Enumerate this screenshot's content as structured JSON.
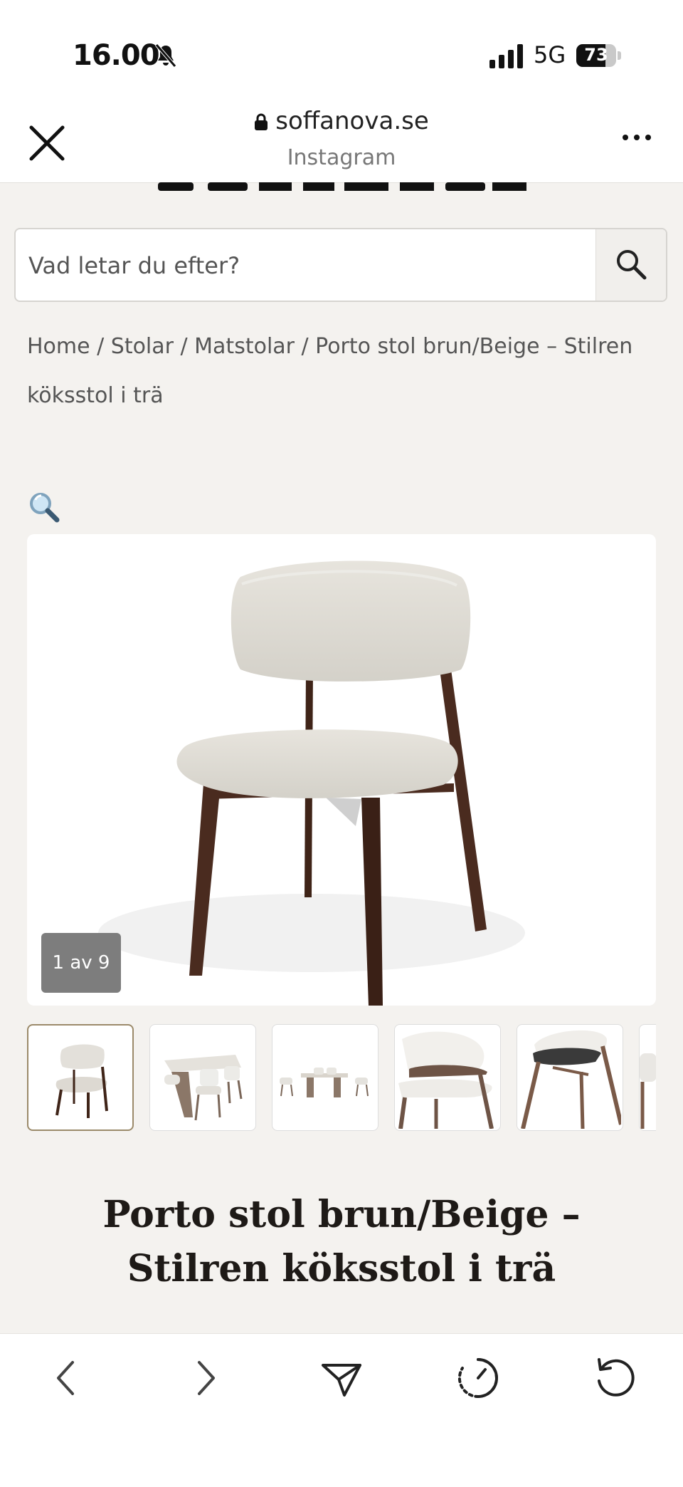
{
  "status": {
    "time": "16.00",
    "network": "5G",
    "battery": "73",
    "battery_level": 0.73
  },
  "appbar": {
    "domain": "soffanova.se",
    "source": "Instagram"
  },
  "search": {
    "placeholder": "Vad letar du efter?"
  },
  "breadcrumb": {
    "line1": "Home / Stolar / Matstolar / Porto stol brun/Beige – Stilren",
    "line2": "köksstol i trä"
  },
  "gallery": {
    "counter": "1 av 9",
    "thumbnails": [
      "chair-front",
      "dining-set-1",
      "dining-set-2",
      "chair-back-detail",
      "chair-side-detail",
      "more"
    ]
  },
  "product": {
    "title": "Porto stol brun/Beige – Stilren köksstol i trä"
  },
  "colors": {
    "upholstery": "#dedbd3",
    "wood": "#4a2b1f",
    "background": "#f4f2ef"
  }
}
